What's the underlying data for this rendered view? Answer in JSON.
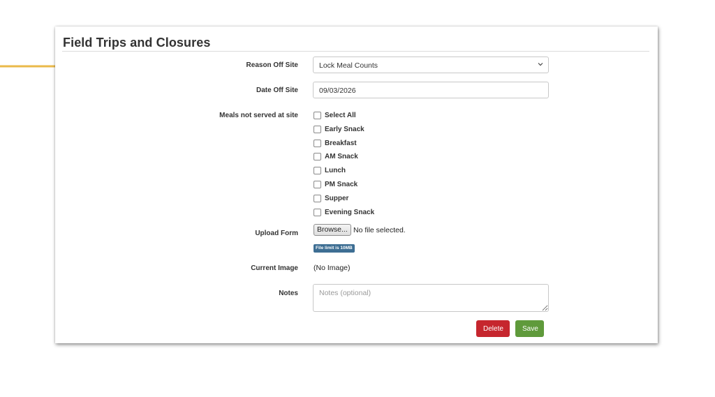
{
  "panel": {
    "title": "Field Trips and Closures"
  },
  "form": {
    "reason": {
      "label": "Reason Off Site",
      "value": "Lock Meal Counts"
    },
    "date": {
      "label": "Date Off Site",
      "value": "09/03/2026"
    },
    "meals": {
      "label": "Meals not served at site",
      "options": [
        "Select All",
        "Early Snack",
        "Breakfast",
        "AM Snack",
        "Lunch",
        "PM Snack",
        "Supper",
        "Evening Snack"
      ]
    },
    "upload": {
      "label": "Upload Form",
      "browse_label": "Browse...",
      "file_status": "No file selected.",
      "limit_badge": "File limit is 10MB"
    },
    "current_image": {
      "label": "Current Image",
      "value": "(No Image)"
    },
    "notes": {
      "label": "Notes",
      "placeholder": "Notes (optional)"
    }
  },
  "actions": {
    "delete_label": "Delete",
    "save_label": "Save"
  },
  "colors": {
    "arrow": "#eab94a",
    "delete": "#c6262e",
    "save": "#5f9a3b",
    "badge": "#3d6e93"
  }
}
